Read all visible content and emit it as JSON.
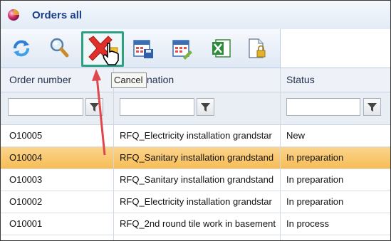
{
  "window": {
    "title": "Orders all"
  },
  "toolbar": {
    "buttons": [
      {
        "name": "refresh",
        "icon": "refresh-icon"
      },
      {
        "name": "search",
        "icon": "magnifier-icon"
      },
      {
        "name": "cancel",
        "icon": "red-x-icon",
        "tooltip": "Cancel"
      },
      {
        "name": "calendar-save",
        "icon": "calendar-save-icon"
      },
      {
        "name": "calendar-edit",
        "icon": "calendar-edit-icon"
      },
      {
        "name": "excel-export",
        "icon": "excel-icon"
      },
      {
        "name": "locked-document",
        "icon": "locked-document-icon"
      }
    ]
  },
  "grid": {
    "columns": [
      "Order number",
      "nation",
      "Status"
    ],
    "rows": [
      {
        "order": "O10005",
        "designation": "RFQ_Electricity installation grandstar",
        "status": "New",
        "selected": false
      },
      {
        "order": "O10004",
        "designation": "RFQ_Sanitary installation grandstand",
        "status": "In preparation",
        "selected": true
      },
      {
        "order": "O10003",
        "designation": "RFQ_Sanitary installation grandstand",
        "status": "In preparation",
        "selected": false
      },
      {
        "order": "O10002",
        "designation": "RFQ_Electricity installation grandstar",
        "status": "In preparation",
        "selected": false
      },
      {
        "order": "O10001",
        "designation": "RFQ_2nd round tile work in basement",
        "status": "In process",
        "selected": false
      }
    ]
  },
  "colors": {
    "highlight_box": "#2ea082",
    "selected_row": "#f7bd56",
    "arrow": "#e0474c",
    "title": "#1c3f8a"
  }
}
